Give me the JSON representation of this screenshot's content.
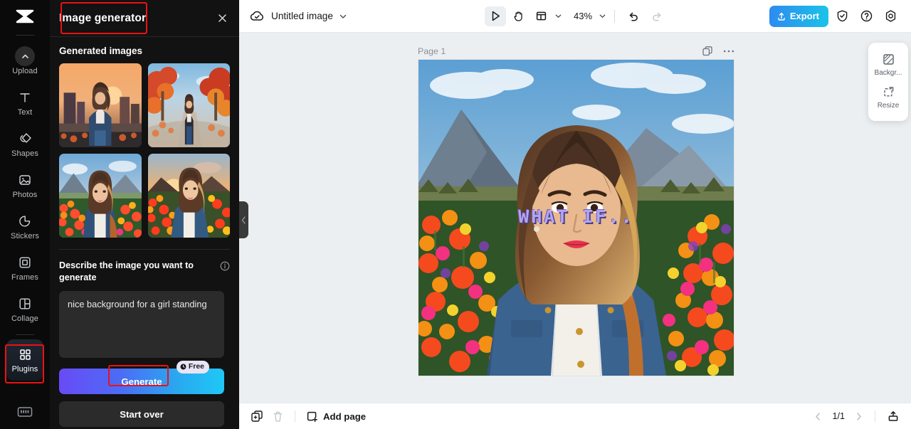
{
  "sidebar": {
    "logo": "capcut-logo",
    "items": [
      {
        "label": "Upload",
        "icon": "upload-chevron-icon",
        "active": false
      },
      {
        "label": "Text",
        "icon": "text-t-icon",
        "active": false
      },
      {
        "label": "Shapes",
        "icon": "shapes-icon",
        "active": false
      },
      {
        "label": "Photos",
        "icon": "photo-icon",
        "active": false
      },
      {
        "label": "Stickers",
        "icon": "sticker-icon",
        "active": false
      },
      {
        "label": "Frames",
        "icon": "frames-icon",
        "active": false
      },
      {
        "label": "Collage",
        "icon": "collage-icon",
        "active": false
      },
      {
        "label": "Plugins",
        "icon": "plugins-grid-icon",
        "active": true
      }
    ],
    "bottom_icon": "keyboard-shortcuts-icon"
  },
  "panel": {
    "title": "Image generator",
    "close_icon": "close-icon",
    "section_title": "Generated images",
    "generated_images": [
      {
        "alt": "woman in denim jacket at city sunset"
      },
      {
        "alt": "woman walking on autumn tree path"
      },
      {
        "alt": "woman in flower field with mountains"
      },
      {
        "alt": "woman in flower field at golden sunset"
      }
    ],
    "describe_label": "Describe the image you want to generate",
    "info_icon": "info-icon",
    "prompt_value": "nice background for a girl standing",
    "prompt_placeholder": "Describe the image you want to generate",
    "generate_label": "Generate",
    "free_badge": "Free",
    "free_badge_icon": "clock-icon",
    "start_over_label": "Start over",
    "collapse_icon": "chevron-left-icon"
  },
  "topbar": {
    "cloud_icon": "cloud-saved-icon",
    "doc_title": "Untitled image",
    "doc_chevron": "chevron-down-icon",
    "tools": [
      {
        "name": "select-tool",
        "icon": "cursor-arrow-icon",
        "selected": true
      },
      {
        "name": "hand-tool",
        "icon": "hand-icon",
        "selected": false
      },
      {
        "name": "layout-tool",
        "icon": "layout-icon",
        "selected": false
      }
    ],
    "zoom_level": "43%",
    "undo_icon": "undo-icon",
    "redo_icon": "redo-icon",
    "export_label": "Export",
    "export_icon": "upload-arrow-icon",
    "right_icons": [
      {
        "name": "shield-check-icon"
      },
      {
        "name": "help-question-icon"
      },
      {
        "name": "settings-gear-icon"
      }
    ],
    "accent_color": "#2d8bf0"
  },
  "canvas": {
    "page_label": "Page 1",
    "duplicate_icon": "duplicate-page-icon",
    "more_icon": "more-options-icon",
    "overlay_text": "WHAT IF..",
    "overlay_text_color": "#b4a4f0"
  },
  "float_panel": {
    "items": [
      {
        "label": "Backgr...",
        "icon": "background-icon"
      },
      {
        "label": "Resize",
        "icon": "resize-icon"
      }
    ]
  },
  "bottombar": {
    "duplicate_icon": "duplicate-icon",
    "delete_icon": "trash-icon",
    "add_page_label": "Add page",
    "add_page_icon": "add-page-icon",
    "prev_icon": "chevron-left-icon",
    "page_indicator": "1/1",
    "next_icon": "chevron-right-icon",
    "export_bottom_icon": "export-tray-icon"
  },
  "highlights": {
    "color": "#ee1111",
    "boxes": [
      "panel-title-highlight",
      "plugins-item-highlight",
      "generate-button-highlight"
    ]
  }
}
